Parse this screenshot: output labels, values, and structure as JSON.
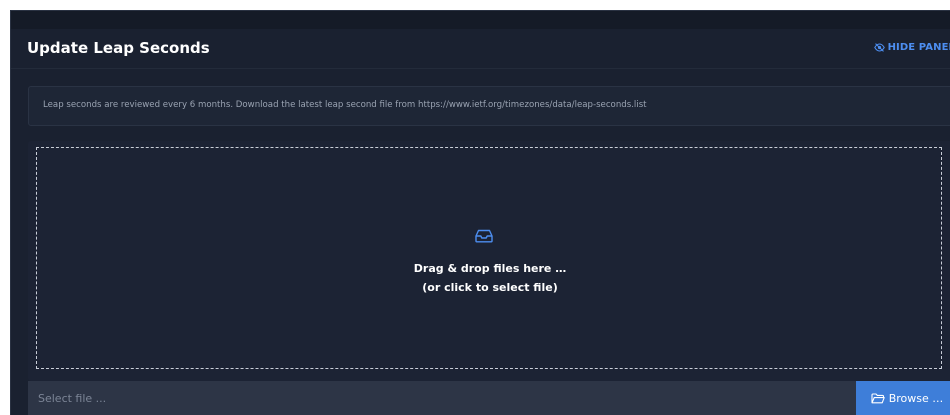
{
  "panel": {
    "title": "Update Leap Seconds",
    "hide_label": "HIDE PANEL",
    "hide_icon": "eye-slash-icon"
  },
  "info": {
    "text": "Leap seconds are reviewed every 6 months. Download the latest leap second file from https://www.ietf.org/timezones/data/leap-seconds.list"
  },
  "dropzone": {
    "icon": "inbox-icon",
    "line1": "Drag & drop files here …",
    "line2": "(or click to select file)"
  },
  "file_input": {
    "placeholder": "Select file ...",
    "value": ""
  },
  "browse": {
    "label": "Browse …",
    "icon": "folder-open-icon"
  },
  "colors": {
    "background": "#1a2130",
    "accent": "#3e7ed9",
    "link": "#4d8ef0"
  }
}
